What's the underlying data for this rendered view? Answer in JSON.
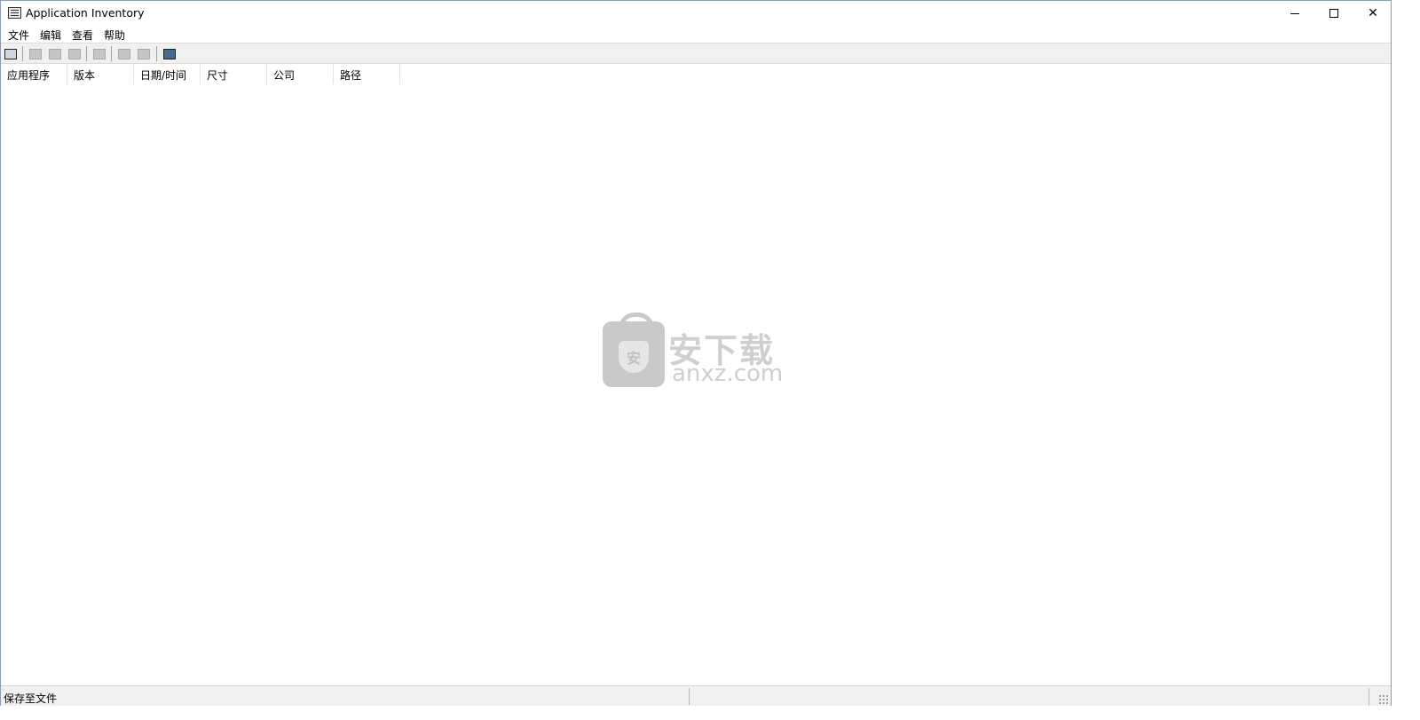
{
  "window": {
    "title": "Application Inventory"
  },
  "menu": {
    "items": [
      "文件",
      "编辑",
      "查看",
      "帮助"
    ]
  },
  "toolbar": {
    "icons": [
      "find-icon",
      "properties-icon",
      "share-icon",
      "copy-icon",
      "save-icon",
      "print-icon",
      "print-preview-icon",
      "exit-icon"
    ]
  },
  "table": {
    "columns": [
      "应用程序",
      "版本",
      "日期/时间",
      "尺寸",
      "公司",
      "路径"
    ],
    "rows": []
  },
  "watermark": {
    "cn": "安下载",
    "en": "anxz.com",
    "badge": "安"
  },
  "status": {
    "text": "保存至文件"
  }
}
